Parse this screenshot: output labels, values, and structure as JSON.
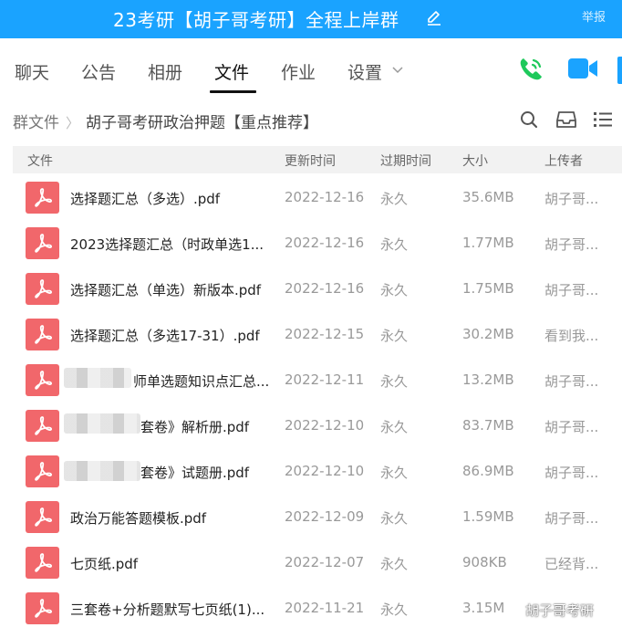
{
  "titlebar": {
    "title": "23考研【胡子哥考研】全程上岸群",
    "report": "举报"
  },
  "tabs": [
    "聊天",
    "公告",
    "相册",
    "文件",
    "作业",
    "设置"
  ],
  "active_tab": "文件",
  "breadcrumb": {
    "root": "群文件",
    "current": "胡子哥考研政治押题【重点推荐】"
  },
  "table": {
    "headers": {
      "file": "文件",
      "updated": "更新时间",
      "expire": "过期时间",
      "size": "大小",
      "uploader": "上传者"
    },
    "rows": [
      {
        "name": "选择题汇总（多选）.pdf",
        "date": "2022-12-16",
        "expire": "永久",
        "size": "35.6MB",
        "uploader": "胡子哥..."
      },
      {
        "name": "2023选择题汇总（时政单选1...",
        "date": "2022-12-16",
        "expire": "永久",
        "size": "1.77MB",
        "uploader": "胡子哥..."
      },
      {
        "name": "选择题汇总（单选）新版本.pdf",
        "date": "2022-12-16",
        "expire": "永久",
        "size": "1.75MB",
        "uploader": "胡子哥..."
      },
      {
        "name": "选择题汇总（多选17-31）.pdf",
        "date": "2022-12-15",
        "expire": "永久",
        "size": "30.2MB",
        "uploader": "看到我..."
      },
      {
        "name": "师单选题知识点汇总...",
        "date": "2022-12-11",
        "expire": "永久",
        "size": "13.2MB",
        "uploader": "胡子哥..."
      },
      {
        "name": "套卷》解析册.pdf",
        "date": "2022-12-10",
        "expire": "永久",
        "size": "83.7MB",
        "uploader": "胡子哥..."
      },
      {
        "name": "套卷》试题册.pdf",
        "date": "2022-12-10",
        "expire": "永久",
        "size": "86.9MB",
        "uploader": "胡子哥..."
      },
      {
        "name": "政治万能答题模板.pdf",
        "date": "2022-12-09",
        "expire": "永久",
        "size": "1.59MB",
        "uploader": "胡子哥..."
      },
      {
        "name": "七页纸.pdf",
        "date": "2022-12-07",
        "expire": "永久",
        "size": "908KB",
        "uploader": "已经背..."
      },
      {
        "name": "三套卷+分析题默写七页纸(1)...",
        "date": "2022-11-21",
        "expire": "永久",
        "size": "3.15M",
        "uploader": ""
      }
    ]
  },
  "watermark": "胡子哥考研",
  "colors": {
    "titlebar": "#1aa3ff",
    "pdf_icon": "#f1676b",
    "call_icon": "#1ec95b",
    "video_icon": "#1aa3ff"
  }
}
